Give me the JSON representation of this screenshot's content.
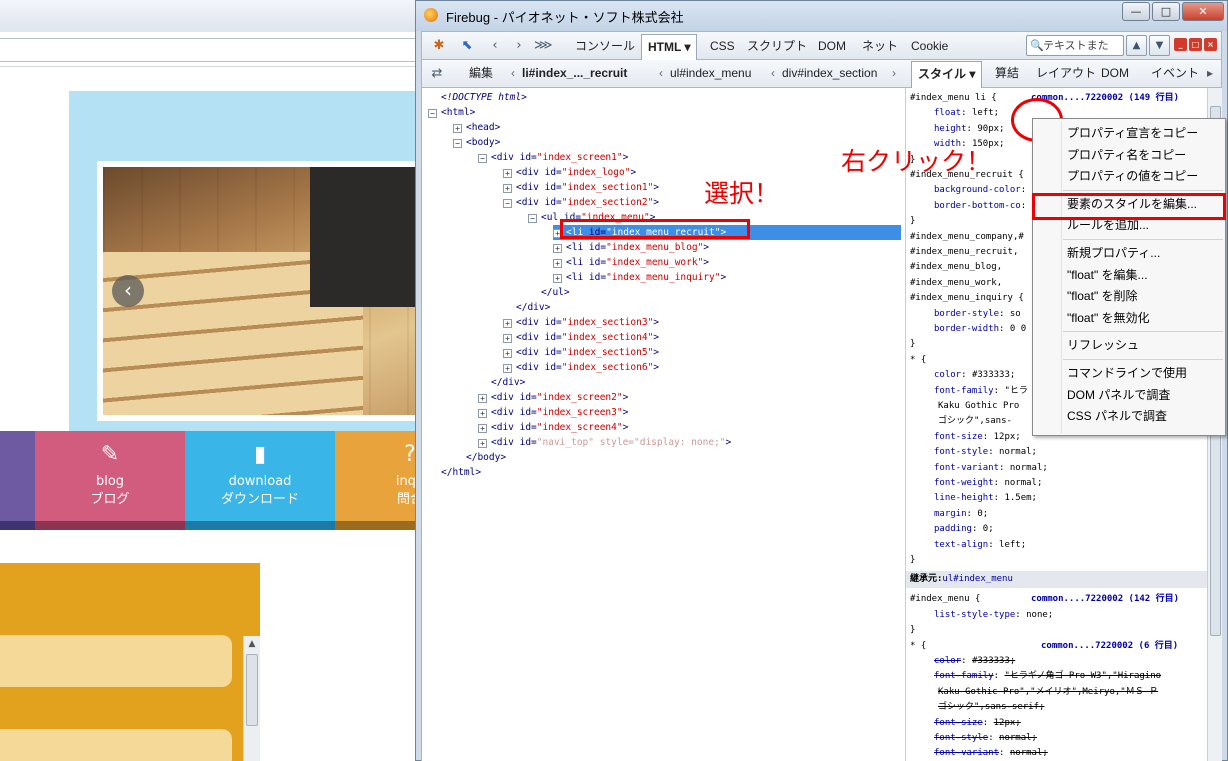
{
  "background_site": {
    "nav_tiles": [
      {
        "label_en": "blog",
        "label_ja": "ブログ",
        "color": "#d15c7d",
        "stripe": "#8b3552",
        "icon": "pencil-note-icon"
      },
      {
        "label_en": "download",
        "label_ja": "ダウンロード",
        "color": "#3ab5e8",
        "stripe": "#1d7aa5",
        "icon": "book-icon"
      },
      {
        "label_en": "inqu",
        "label_ja": "問合",
        "color": "#e9a33c",
        "stripe": "#9b6b1e",
        "icon": "question-icon"
      }
    ],
    "slider_arrow": "‹",
    "colors": {
      "hero": "#b4e2f4",
      "orange_panel": "#e2a21d",
      "purple_tile": "#6e5aa3"
    }
  },
  "firebug": {
    "title": "Firebug - パイオネット・ソフト株式会社",
    "window_buttons": {
      "minimize": "—",
      "maximize": "□",
      "close": "✕"
    },
    "toolbar": {
      "tabs": [
        "コンソール",
        "HTML ▾",
        "CSS",
        "スクリプト",
        "DOM",
        "ネット",
        "Cookie"
      ],
      "active_tab": "HTML ▾",
      "search_placeholder": "テキストまた",
      "search_icon": "🔍"
    },
    "breadcrumb": {
      "edit_label": "編集",
      "path": [
        "li#index_..._recruit",
        "ul#index_menu",
        "div#index_section"
      ],
      "side_tabs": [
        "スタイル ▾",
        "算結",
        "レイアウト",
        "DOM",
        "イベント"
      ],
      "active_side_tab": "スタイル ▾"
    },
    "tree": [
      {
        "indent": 0,
        "toggle": "",
        "text": "<!DOCTYPE html>",
        "dim": true
      },
      {
        "indent": 0,
        "toggle": "−",
        "text": "<html>"
      },
      {
        "indent": 1,
        "toggle": "+",
        "text": "<head>"
      },
      {
        "indent": 1,
        "toggle": "−",
        "text": "<body>"
      },
      {
        "indent": 2,
        "toggle": "−",
        "tag": "<div",
        "attr": " id=",
        "val": "\"index_screen1\"",
        "end": ">"
      },
      {
        "indent": 3,
        "toggle": "+",
        "tag": "<div",
        "attr": " id=",
        "val": "\"index_logo\"",
        "end": ">"
      },
      {
        "indent": 3,
        "toggle": "+",
        "tag": "<div",
        "attr": " id=",
        "val": "\"index_section1\"",
        "end": ">"
      },
      {
        "indent": 3,
        "toggle": "−",
        "tag": "<div",
        "attr": " id=",
        "val": "\"index_section2\"",
        "end": ">"
      },
      {
        "indent": 4,
        "toggle": "−",
        "tag": "<ul",
        "attr": " id=",
        "val": "\"index_menu\"",
        "end": ">"
      },
      {
        "indent": 5,
        "toggle": "+",
        "tag": "<li",
        "attr": " id=",
        "val": "\"index_menu_recruit\"",
        "end": ">",
        "selected": true
      },
      {
        "indent": 5,
        "toggle": "+",
        "tag": "<li",
        "attr": " id=",
        "val": "\"index_menu_blog\"",
        "end": ">"
      },
      {
        "indent": 5,
        "toggle": "+",
        "tag": "<li",
        "attr": " id=",
        "val": "\"index_menu_work\"",
        "end": ">"
      },
      {
        "indent": 5,
        "toggle": "+",
        "tag": "<li",
        "attr": " id=",
        "val": "\"index_menu_inquiry\"",
        "end": ">"
      },
      {
        "indent": 4,
        "toggle": "",
        "text": "</ul>"
      },
      {
        "indent": 3,
        "toggle": "",
        "text": "</div>"
      },
      {
        "indent": 3,
        "toggle": "+",
        "tag": "<div",
        "attr": " id=",
        "val": "\"index_section3\"",
        "end": ">"
      },
      {
        "indent": 3,
        "toggle": "+",
        "tag": "<div",
        "attr": " id=",
        "val": "\"index_section4\"",
        "end": ">"
      },
      {
        "indent": 3,
        "toggle": "+",
        "tag": "<div",
        "attr": " id=",
        "val": "\"index_section5\"",
        "end": ">"
      },
      {
        "indent": 3,
        "toggle": "+",
        "tag": "<div",
        "attr": " id=",
        "val": "\"index_section6\"",
        "end": ">"
      },
      {
        "indent": 2,
        "toggle": "",
        "text": "</div>"
      },
      {
        "indent": 2,
        "toggle": "+",
        "tag": "<div",
        "attr": " id=",
        "val": "\"index_screen2\"",
        "end": ">"
      },
      {
        "indent": 2,
        "toggle": "+",
        "tag": "<div",
        "attr": " id=",
        "val": "\"index_screen3\"",
        "end": ">"
      },
      {
        "indent": 2,
        "toggle": "+",
        "tag": "<div",
        "attr": " id=",
        "val": "\"index_screen4\"",
        "end": ">"
      },
      {
        "indent": 2,
        "toggle": "+",
        "tag": "<div",
        "attr": " id=",
        "val": "\"navi_top\" style=\"display: none;\"",
        "end": ">",
        "dim": true
      },
      {
        "indent": 1,
        "toggle": "",
        "text": "</body>"
      },
      {
        "indent": 0,
        "toggle": "",
        "text": "</html>"
      }
    ],
    "style_rows": [
      {
        "sel": "#index_menu li {",
        "src": "common....7220002 (149 行目)"
      },
      {
        "pn": "float",
        "pv": "left;"
      },
      {
        "pn": "height",
        "pv": "90px;"
      },
      {
        "pn": "width",
        "pv": "150px;"
      },
      {
        "sel": "}"
      },
      {
        "sel": "#index_menu_recruit {"
      },
      {
        "pn": "background-color",
        "pv": ""
      },
      {
        "pn": "border-bottom-co",
        "pv": ""
      },
      {
        "sel": "}"
      },
      {
        "sel": "#index_menu_company,#"
      },
      {
        "sel": "#index_menu_recruit,"
      },
      {
        "sel": "#index_menu_blog,"
      },
      {
        "sel": "#index_menu_work,"
      },
      {
        "sel": "#index_menu_inquiry {"
      },
      {
        "pn": "border-style",
        "pv": "so"
      },
      {
        "pn": "border-width",
        "pv": "0 0"
      },
      {
        "sel": "}"
      },
      {
        "sel": "* {"
      },
      {
        "pn": "color",
        "pv": "#333333;"
      },
      {
        "pn": "font-family",
        "pv": "\"ヒラ"
      },
      {
        "cont": "Kaku Gothic Pro"
      },
      {
        "cont": "ゴシック\",sans-"
      },
      {
        "pn": "font-size",
        "pv": "12px;"
      },
      {
        "pn": "font-style",
        "pv": "normal;"
      },
      {
        "pn": "font-variant",
        "pv": "normal;"
      },
      {
        "pn": "font-weight",
        "pv": "normal;"
      },
      {
        "pn": "line-height",
        "pv": "1.5em;"
      },
      {
        "pn": "margin",
        "pv": "0;"
      },
      {
        "pn": "padding",
        "pv": "0;"
      },
      {
        "pn": "text-align",
        "pv": "left;"
      },
      {
        "sel": "}"
      }
    ],
    "inherited_label": "継承元:",
    "inherited_from": "ul#index_menu",
    "inherited_rows": [
      {
        "sel": "#index_menu {",
        "src": "common....7220002 (142 行目)"
      },
      {
        "pn": "list-style-type",
        "pv": "none;"
      },
      {
        "sel": "}"
      },
      {
        "sel": "* {",
        "src": "common....7220002 (6 行目)"
      },
      {
        "pn": "color",
        "pv": "#333333;",
        "strike": true
      },
      {
        "pn": "font-family",
        "pv": "\"ヒラギノ角ゴ Pro W3\",\"Hiragino",
        "strike": true
      },
      {
        "cont": "Kaku Gothic Pro\",\"メイリオ\",Meiryo,\"ＭＳ Ｐ",
        "strike": true
      },
      {
        "cont": "ゴシック\",sans-serif;",
        "strike": true
      },
      {
        "pn": "font-size",
        "pv": "12px;",
        "strike": true
      },
      {
        "pn": "font-style",
        "pv": "normal;",
        "strike": true
      },
      {
        "pn": "font-variant",
        "pv": "normal;",
        "strike": true
      },
      {
        "pn": "font-weight",
        "pv": "normal;",
        "strike": true
      }
    ]
  },
  "context_menu": {
    "items": [
      {
        "label": "プロパティ宣言をコピー"
      },
      {
        "label": "プロパティ名をコピー"
      },
      {
        "label": "プロパティの値をコピー"
      },
      {
        "sep": true
      },
      {
        "label": "要素のスタイルを編集...",
        "highlight": true
      },
      {
        "label": "ルールを追加..."
      },
      {
        "sep": true
      },
      {
        "label": "新規プロパティ..."
      },
      {
        "label": "\"float\" を編集..."
      },
      {
        "label": "\"float\" を削除"
      },
      {
        "label": "\"float\" を無効化"
      },
      {
        "sep": true
      },
      {
        "label": "リフレッシュ"
      },
      {
        "sep": true
      },
      {
        "label": "コマンドラインで使用"
      },
      {
        "label": "DOM パネルで調査"
      },
      {
        "label": "CSS パネルで調査"
      }
    ]
  },
  "annotations": {
    "select": "選択！",
    "right_click": "右クリック！",
    "color": "#e00000"
  }
}
